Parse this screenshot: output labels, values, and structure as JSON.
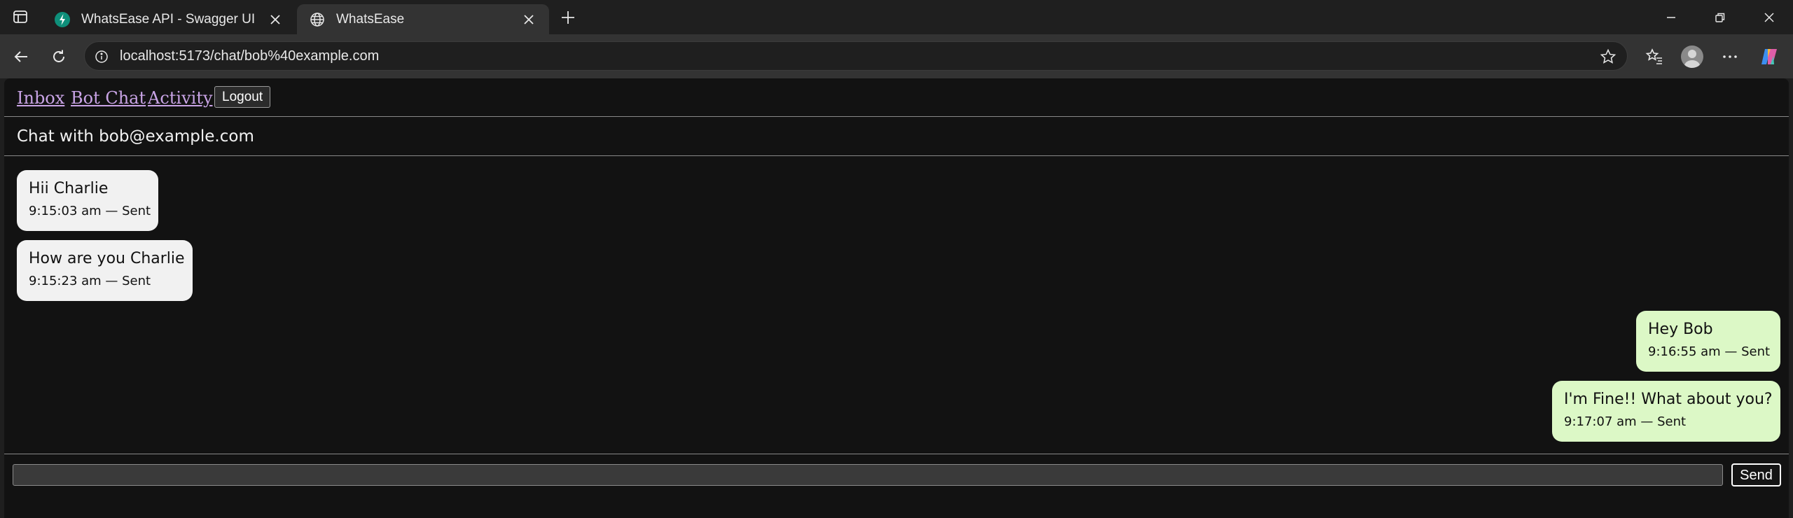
{
  "browser": {
    "tabs": [
      {
        "title": "WhatsEase API - Swagger UI",
        "active": false
      },
      {
        "title": "WhatsEase",
        "active": true
      }
    ],
    "url": "localhost:5173/chat/bob%40example.com"
  },
  "nav": {
    "links": [
      "Inbox",
      "Bot Chat",
      "Activity"
    ],
    "logout_label": "Logout"
  },
  "chat": {
    "header": "Chat with bob@example.com",
    "messages": [
      {
        "text": "Hii Charlie",
        "meta": "9:15:03 am — Sent",
        "direction": "incoming"
      },
      {
        "text": "How are you Charlie",
        "meta": "9:15:23 am — Sent",
        "direction": "incoming"
      },
      {
        "text": "Hey Bob",
        "meta": "9:16:55 am — Sent",
        "direction": "outgoing"
      },
      {
        "text": "I'm Fine!! What about you?",
        "meta": "9:17:07 am — Sent",
        "direction": "outgoing"
      }
    ]
  },
  "composer": {
    "input_value": "",
    "send_label": "Send"
  },
  "colors": {
    "incoming_bubble": "#f1f1f1",
    "outgoing_bubble": "#dcf8c6",
    "link": "#c9a4e6",
    "page_bg": "#121212"
  }
}
